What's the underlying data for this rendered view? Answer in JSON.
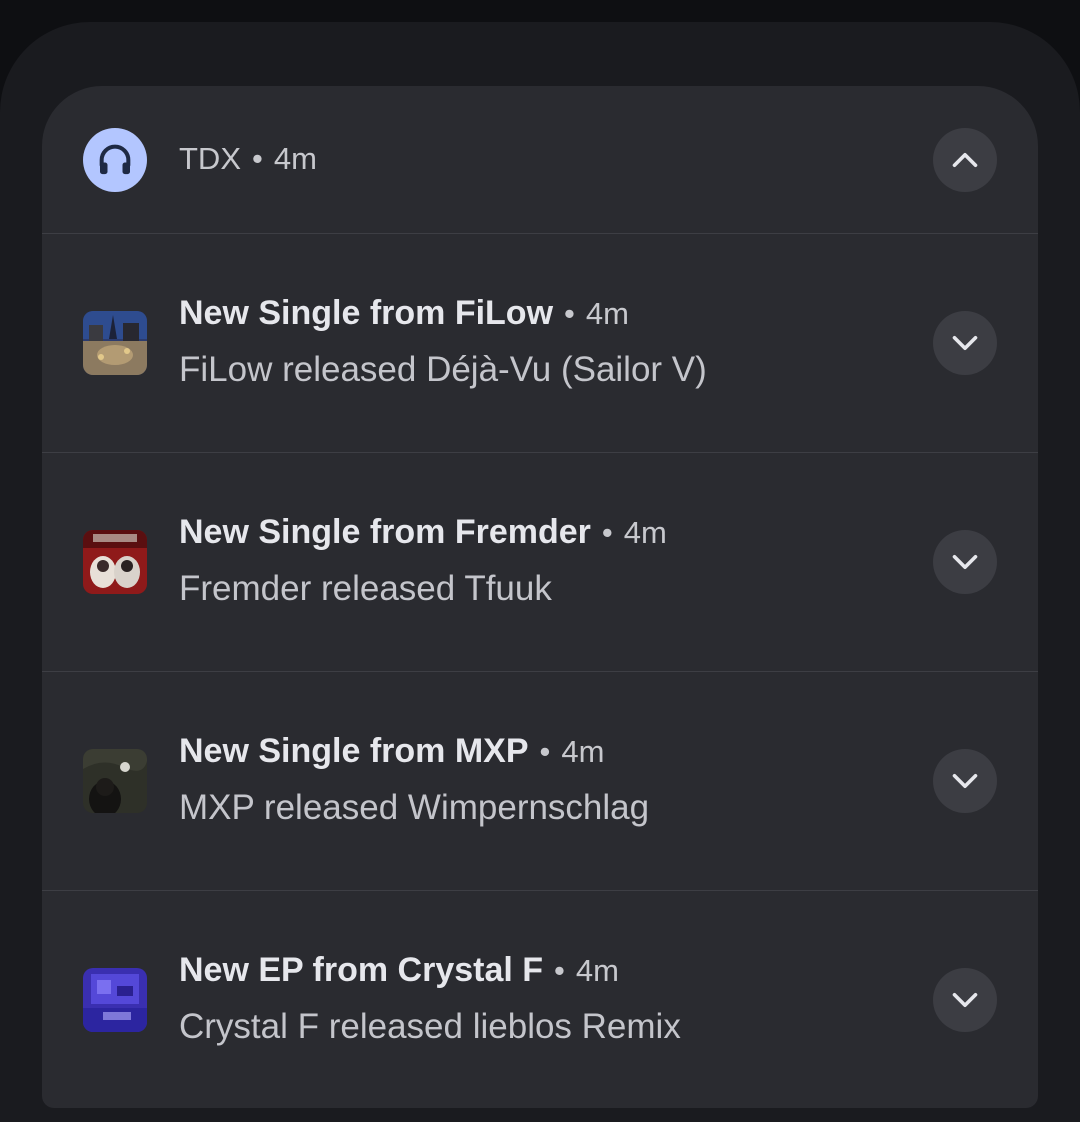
{
  "group": {
    "app_name": "TDX",
    "separator": "•",
    "time": "4m",
    "icon": "headphones-icon",
    "collapse_icon": "chevron-up-icon"
  },
  "notifications": [
    {
      "title": "New Single from FiLow",
      "time": "4m",
      "body": "FiLow released Déjà-Vu (Sailor V)",
      "expand_icon": "chevron-down-icon"
    },
    {
      "title": "New Single from Fremder",
      "time": "4m",
      "body": "Fremder released Tfuuk",
      "expand_icon": "chevron-down-icon"
    },
    {
      "title": "New Single from MXP",
      "time": "4m",
      "body": "MXP released Wimpernschlag",
      "expand_icon": "chevron-down-icon"
    },
    {
      "title": "New EP from Crystal F",
      "time": "4m",
      "body": "Crystal F released lieblos Remix",
      "expand_icon": "chevron-down-icon"
    }
  ],
  "colors": {
    "background": "#0e0f12",
    "shade": "#1a1b1f",
    "card": "#2a2b30",
    "app_icon_bg": "#b3c6ff",
    "button_bg": "#3c3d43"
  }
}
